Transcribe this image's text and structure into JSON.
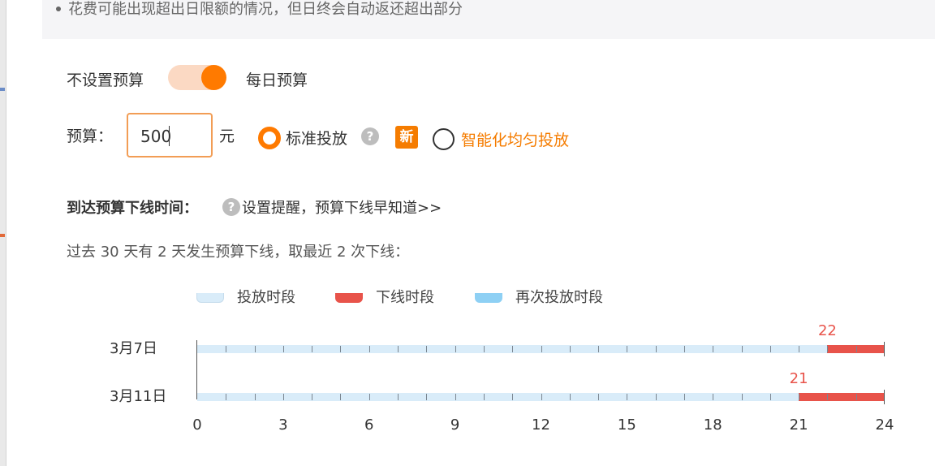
{
  "tip": {
    "text": "花费可能出现超出日限额的情况，但日终会自动返还超出部分"
  },
  "budget_mode": {
    "left_label": "不设置预算",
    "right_label": "每日预算",
    "enabled": true
  },
  "budget": {
    "label": "预算：",
    "value": "500",
    "unit": "元"
  },
  "delivery": {
    "standard_label": "标准投放",
    "smart_label": "智能化均匀投放",
    "new_badge": "新",
    "help_icon": "question-icon",
    "selected": "standard"
  },
  "offline": {
    "heading": "到达预算下线时间：",
    "link_text": "设置提醒，预算下线早知道>>",
    "summary": "过去 30 天有 2 天发生预算下线，取最近 2 次下线："
  },
  "colors": {
    "accent": "#ff7a00",
    "delivery": "#d9ecf9",
    "offline": "#e8534a",
    "redelivery": "#8ed0f4"
  },
  "chart_data": {
    "type": "timeline",
    "legend": [
      {
        "label": "投放时段",
        "color": "#d9ecf9"
      },
      {
        "label": "下线时段",
        "color": "#e8534a"
      },
      {
        "label": "再次投放时段",
        "color": "#8ed0f4"
      }
    ],
    "xlim": [
      0,
      24
    ],
    "x_ticks": [
      "0",
      "3",
      "6",
      "9",
      "12",
      "15",
      "18",
      "21",
      "24"
    ],
    "rows": [
      {
        "date": "3月7日",
        "offline_start": 22,
        "offline_end": 24,
        "marker": "22"
      },
      {
        "date": "3月11日",
        "offline_start": 21,
        "offline_end": 24,
        "marker": "21"
      }
    ]
  }
}
